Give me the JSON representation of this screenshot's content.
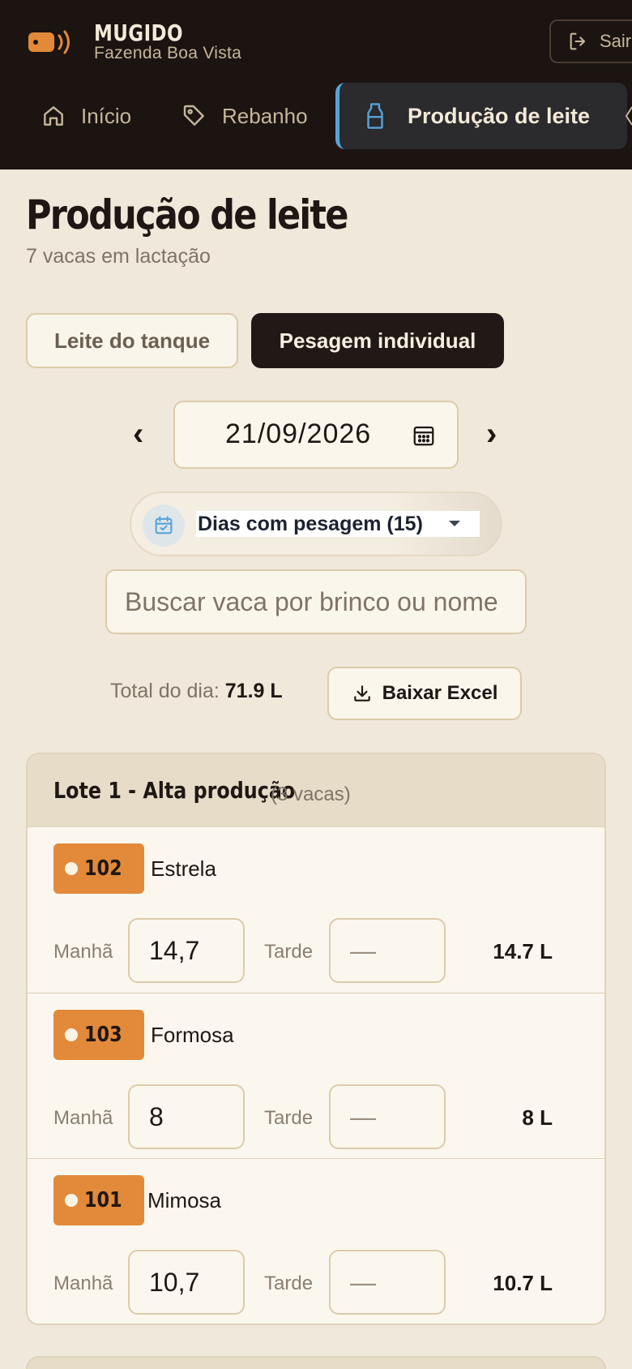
{
  "header": {
    "brand": "MUGIDO",
    "farm": "Fazenda Boa Vista",
    "exit_label": "Sair",
    "colors": {
      "background": "#1b1411",
      "accent": "#e28a3a",
      "active_border": "#57a3d8"
    },
    "nav": [
      {
        "label": "Início",
        "icon": "home-icon"
      },
      {
        "label": "Rebanho",
        "icon": "tag-icon"
      },
      {
        "label": "Produção de leite",
        "icon": "milk-bottle-icon",
        "active": true
      }
    ]
  },
  "page": {
    "title": "Produção de leite",
    "subtitle": "7 vacas em lactação"
  },
  "tabs": [
    {
      "label": "Leite do tanque",
      "active": false
    },
    {
      "label": "Pesagem individual",
      "active": true
    }
  ],
  "date": {
    "prev": "‹",
    "value": "21/09/2026",
    "next": "›"
  },
  "days_filter": {
    "label": "Dias com pesagem (15)"
  },
  "search": {
    "placeholder": "Buscar vaca por brinco ou nome",
    "value": ""
  },
  "totals": {
    "label": "Total do dia:",
    "value": "71.9 L",
    "excel_label": "Baixar Excel"
  },
  "lot": {
    "title": "Lote 1 - Alta produção",
    "count": "(3 vacas)",
    "morning_label": "Manhã",
    "afternoon_label": "Tarde",
    "cows": [
      {
        "tag": "102",
        "name": "Estrela",
        "morning": "14,7",
        "afternoon": "",
        "afternoon_placeholder": "—",
        "total": "14.7 L"
      },
      {
        "tag": "103",
        "name": "Formosa",
        "morning": "8",
        "afternoon": "",
        "afternoon_placeholder": "—",
        "total": "8 L"
      },
      {
        "tag": "101",
        "name": "Mimosa",
        "morning": "10,7",
        "afternoon": "",
        "afternoon_placeholder": "—",
        "total": "10.7 L"
      }
    ]
  }
}
